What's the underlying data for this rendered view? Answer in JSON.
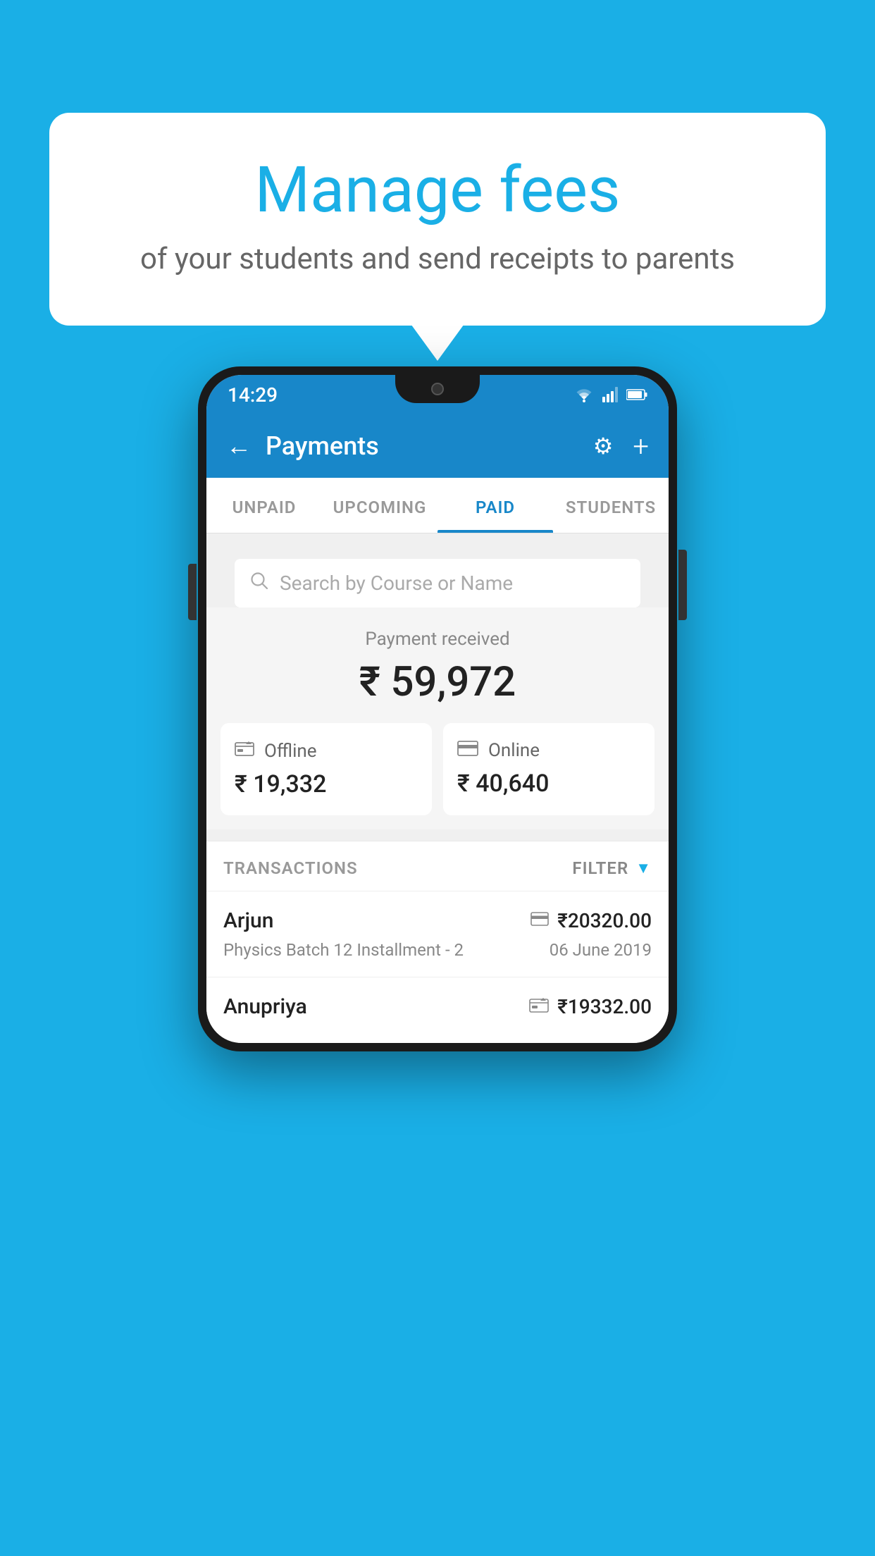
{
  "background_color": "#1AAFE6",
  "speech_bubble": {
    "title": "Manage fees",
    "subtitle": "of your students and send receipts to parents"
  },
  "status_bar": {
    "time": "14:29",
    "wifi": true,
    "signal": true,
    "battery": true
  },
  "app_bar": {
    "title": "Payments",
    "back_label": "←",
    "settings_label": "⚙",
    "add_label": "+"
  },
  "tabs": [
    {
      "id": "unpaid",
      "label": "UNPAID",
      "active": false
    },
    {
      "id": "upcoming",
      "label": "UPCOMING",
      "active": false
    },
    {
      "id": "paid",
      "label": "PAID",
      "active": true
    },
    {
      "id": "students",
      "label": "STUDENTS",
      "active": false
    }
  ],
  "search": {
    "placeholder": "Search by Course or Name"
  },
  "payment_summary": {
    "label": "Payment received",
    "total": "₹ 59,972",
    "offline": {
      "type": "Offline",
      "amount": "₹ 19,332"
    },
    "online": {
      "type": "Online",
      "amount": "₹ 40,640"
    }
  },
  "transactions_section": {
    "label": "TRANSACTIONS",
    "filter_label": "FILTER"
  },
  "transactions": [
    {
      "name": "Arjun",
      "course": "Physics Batch 12 Installment - 2",
      "amount": "₹20320.00",
      "date": "06 June 2019",
      "payment_type": "card"
    },
    {
      "name": "Anupriya",
      "course": "",
      "amount": "₹19332.00",
      "date": "",
      "payment_type": "offline"
    }
  ]
}
